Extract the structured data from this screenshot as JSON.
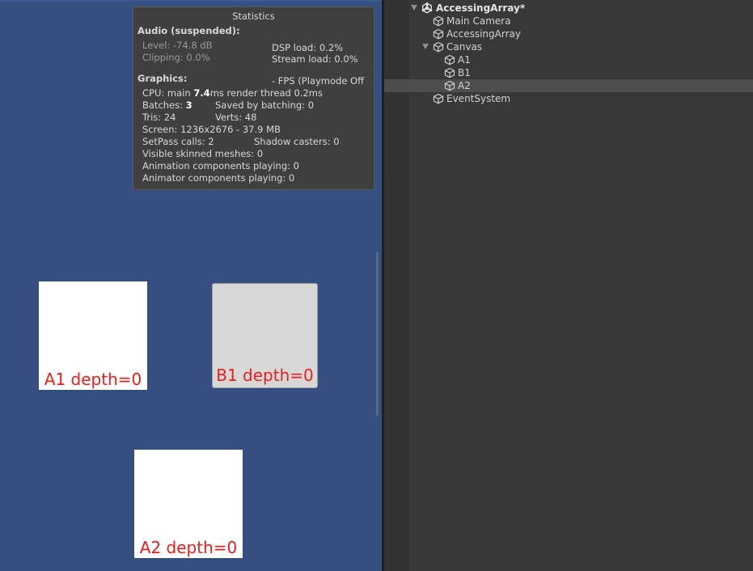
{
  "stats": {
    "title": "Statistics",
    "audio_header": "Audio (suspended):",
    "level": "Level: -74.8 dB",
    "clipping": "Clipping: 0.0%",
    "dsp_load": "DSP load: 0.2%",
    "stream_load": "Stream load: 0.0%",
    "graphics_header": "Graphics:",
    "fps": "- FPS (Playmode Off",
    "cpu_prefix": "CPU: main ",
    "cpu_main": "7.4",
    "cpu_suffix": "ms  render thread 0.2ms",
    "batches_prefix": "Batches: ",
    "batches": "3",
    "saved_by_batching": "Saved by batching: 0",
    "tris": "Tris: 24",
    "verts": "Verts: 48",
    "screen": "Screen: 1236x2676 - 37.9 MB",
    "setpass": "SetPass calls: 2",
    "shadow_casters": "Shadow casters: 0",
    "skinned": "Visible skinned meshes: 0",
    "animation": "Animation components playing: 0",
    "animator": "Animator components playing: 0"
  },
  "game_objects": {
    "a1_label": "A1 depth=0",
    "b1_label": "B1 depth=0",
    "a2_label": "A2 depth=0"
  },
  "hierarchy": {
    "scene": "AccessingArray*",
    "items": {
      "main_camera": "Main Camera",
      "accessing_array": "AccessingArray",
      "canvas": "Canvas",
      "a1": "A1",
      "b1": "B1",
      "a2": "A2",
      "event_system": "EventSystem"
    },
    "selected": "A2"
  },
  "colors": {
    "game_background": "#344f80",
    "label_red": "#e8201c",
    "panel_dark": "#383838",
    "selection": "#4d4d4d"
  }
}
